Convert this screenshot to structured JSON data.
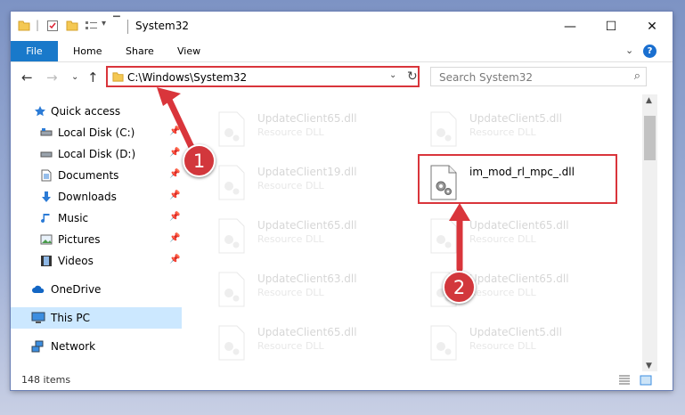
{
  "window": {
    "title": "System32"
  },
  "ribbon": {
    "tabs": [
      "File",
      "Home",
      "Share",
      "View"
    ],
    "help": "?"
  },
  "address_bar": {
    "path": "C:\\Windows\\System32"
  },
  "search": {
    "placeholder": "Search System32"
  },
  "sidebar": {
    "items": [
      {
        "label": "Quick access",
        "icon": "star-icon"
      },
      {
        "label": "Local Disk (C:)",
        "icon": "drive-icon",
        "pinned": true
      },
      {
        "label": "Local Disk (D:)",
        "icon": "drive-icon",
        "pinned": true
      },
      {
        "label": "Documents",
        "icon": "documents-icon",
        "pinned": true
      },
      {
        "label": "Downloads",
        "icon": "download-icon",
        "pinned": true
      },
      {
        "label": "Music",
        "icon": "music-icon",
        "pinned": true
      },
      {
        "label": "Pictures",
        "icon": "pictures-icon",
        "pinned": true
      },
      {
        "label": "Videos",
        "icon": "videos-icon",
        "pinned": true
      },
      {
        "label": "OneDrive",
        "icon": "cloud-icon"
      },
      {
        "label": "This PC",
        "icon": "computer-icon",
        "selected": true
      },
      {
        "label": "Network",
        "icon": "network-icon"
      }
    ]
  },
  "files": {
    "left": [
      {
        "name": "UpdateClient65.dll",
        "type": "Resource DLL"
      },
      {
        "name": "UpdateClient19.dll",
        "type": "Resource DLL"
      },
      {
        "name": "UpdateClient65.dll",
        "type": "Resource DLL"
      },
      {
        "name": "UpdateClient63.dll",
        "type": "Resource DLL"
      },
      {
        "name": "UpdateClient65.dll",
        "type": "Resource DLL"
      }
    ],
    "right": [
      {
        "name": "UpdateClient5.dll",
        "type": "Resource DLL"
      },
      {
        "name": "im_mod_rl_mpc_.dll",
        "type": "",
        "highlighted": true
      },
      {
        "name": "UpdateClient65.dll",
        "type": "Resource DLL"
      },
      {
        "name": "UpdateClient65.dll",
        "type": "Resource DLL"
      },
      {
        "name": "UpdateClient5.dll",
        "type": "Resource DLL"
      }
    ]
  },
  "status": {
    "item_count": "148 items"
  },
  "callouts": {
    "one": "1",
    "two": "2"
  },
  "colors": {
    "accent": "#1979ca",
    "highlight": "#d9353b",
    "selected": "#cce8ff"
  }
}
